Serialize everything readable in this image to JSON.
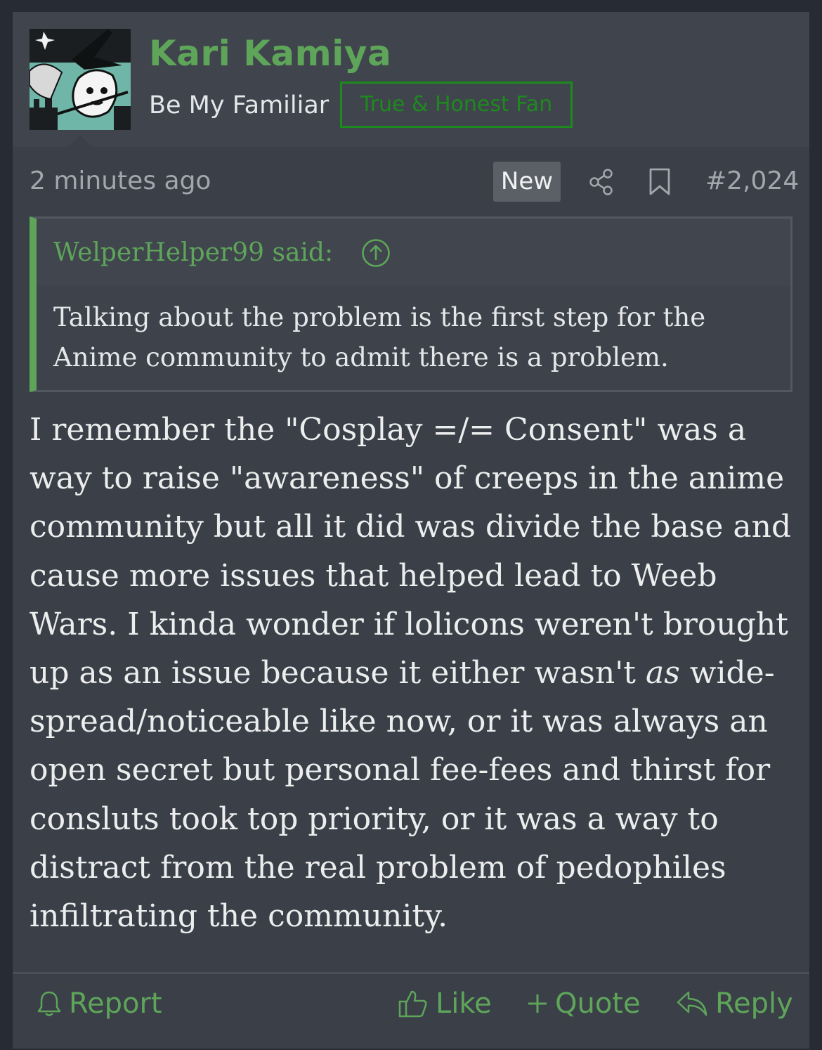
{
  "user": {
    "name": "Kari Kamiya",
    "title": "Be My Familiar",
    "banner": "True & Honest Fan",
    "avatar_icon": "witch-cat-avatar"
  },
  "meta": {
    "time": "2 minutes ago",
    "new_label": "New",
    "post_number": "#2,024",
    "icons": [
      "share-icon",
      "bookmark-icon"
    ]
  },
  "quote": {
    "author": "WelperHelper99 said:",
    "text": "Talking about the problem is the first step for the Anime community to admit there is a problem."
  },
  "message": {
    "part1": "I remember the \"Cosplay =/= Consent\" was a way to raise \"awareness\" of creeps in the anime community but all it did was divide the base and cause more issues that helped lead to Weeb Wars. I kinda wonder if lolicons weren't brought up as an issue because it either wasn't ",
    "emphasis": "as",
    "part2": " wide-spread/noticeable like now, or it was always an open secret but personal fee-fees and thirst for consluts took top priority, or it was a way to distract from the real problem of pedophiles infiltrating the community."
  },
  "actions": {
    "report": "Report",
    "like": "Like",
    "quote": "Quote",
    "reply": "Reply"
  },
  "colors": {
    "accent": "#5ea55a",
    "banner": "#1e8a1e",
    "background": "#3a3f48"
  }
}
